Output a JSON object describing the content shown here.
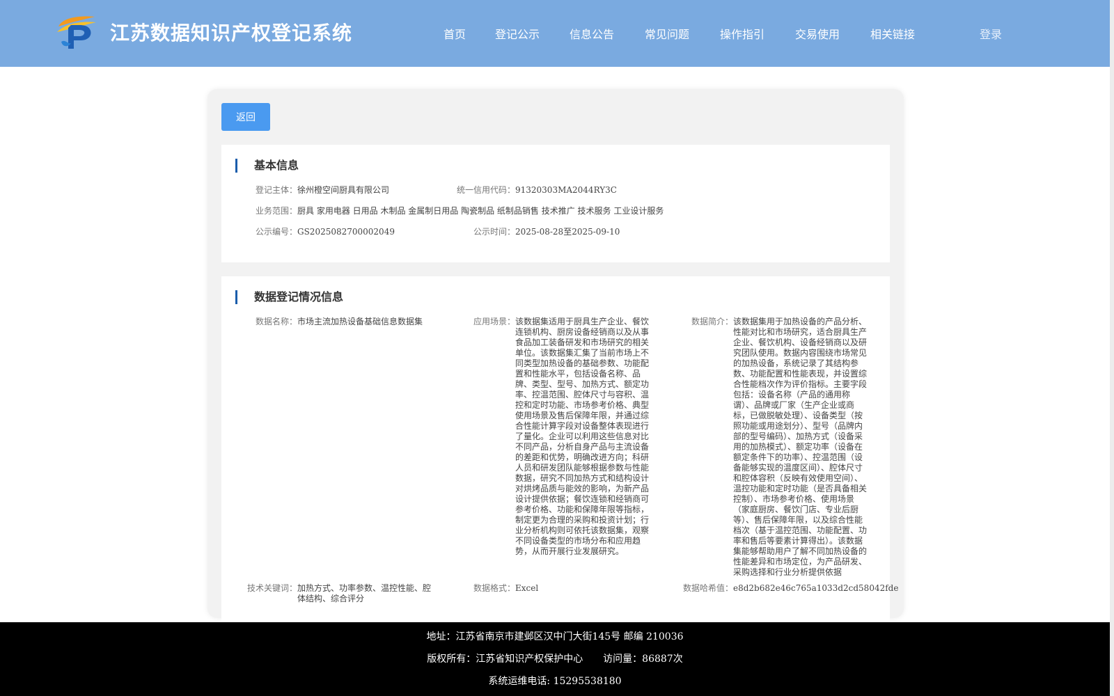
{
  "header": {
    "site_title": "江苏数据知识产权登记系统",
    "nav": [
      "首页",
      "登记公示",
      "信息公告",
      "常见问题",
      "操作指引",
      "交易使用",
      "相关链接"
    ],
    "login": "登录",
    "logo_letter": "P"
  },
  "back_button": "返回",
  "basic_info": {
    "title": "基本信息",
    "fields": [
      {
        "label": "登记主体：",
        "value": "徐州橙空间厨具有限公司"
      },
      {
        "label": "统一信用代码：",
        "value": "91320303MA2044RY3C"
      },
      {
        "label": "业务范围：",
        "value": "厨具 家用电器 日用品 木制品 金属制日用品 陶瓷制品 纸制品销售 技术推广 技术服务 工业设计服务"
      },
      {
        "label": "公示编号：",
        "value": "GS2025082700002049"
      },
      {
        "label": "公示时间：",
        "value": "2025-08-28至2025-09-10"
      }
    ]
  },
  "data_info": {
    "title": "数据登记情况信息",
    "fields": [
      {
        "label": "数据名称：",
        "value": "市场主流加热设备基础信息数据集"
      },
      {
        "label": "应用场景：",
        "value": "该数据集适用于厨具生产企业、餐饮连锁机构、厨房设备经销商以及从事食品加工装备研发和市场研究的相关单位。该数据集汇集了当前市场上不同类型加热设备的基础参数、功能配置和性能水平，包括设备名称、品牌、类型、型号、加热方式、额定功率、控温范围、腔体尺寸与容积、温控和定时功能、市场参考价格、典型使用场景及售后保障年限，并通过综合性能计算字段对设备整体表现进行了量化。企业可以利用这些信息对比不同产品，分析自身产品与主流设备的差距和优势，明确改进方向；科研人员和研发团队能够根据参数与性能数据，研究不同加热方式和结构设计对烘烤品质与能效的影响，为新产品设计提供依据；餐饮连锁和经销商可参考价格、功能和保障年限等指标，制定更为合理的采购和投资计划；行业分析机构则可依托该数据集，观察不同设备类型的市场分布和应用趋势，从而开展行业发展研究。"
      },
      {
        "label": "数据简介：",
        "value": "该数据集用于加热设备的产品分析、性能对比和市场研究，适合厨具生产企业、餐饮机构、设备经销商以及研究团队使用。数据内容围绕市场常见的加热设备，系统记录了其结构参数、功能配置和性能表现，并设置综合性能档次作为评价指标。主要字段包括：设备名称（产品的通用称谓）、品牌或厂家（生产企业或商标，已做脱敏处理）、设备类型（按照功能或用途划分）、型号（品牌内部的型号编码）、加热方式（设备采用的加热模式）、额定功率（设备在额定条件下的功率）、控温范围（设备能够实现的温度区间）、腔体尺寸和腔体容积（反映有效使用空间）、温控功能和定时功能（是否具备相关控制）、市场参考价格、使用场景（家庭厨房、餐饮门店、专业后厨等）、售后保障年限，以及综合性能档次（基于温控范围、功能配置、功率和售后等要素计算得出）。该数据集能够帮助用户了解不同加热设备的性能差异和市场定位，为产品研发、采购选择和行业分析提供依据"
      },
      {
        "label": "技术关键词：",
        "value": "加热方式、功率参数、温控性能、腔体结构、综合评分"
      },
      {
        "label": "数据格式：",
        "value": "Excel"
      },
      {
        "label": "数据哈希值：",
        "value": "e8d2b682e46c765a1033d2cd58042fde"
      }
    ]
  },
  "footer": {
    "address": "地址：江苏省南京市建邺区汉中门大街145号 邮编 210036",
    "copyright": "版权所有：江苏省知识产权保护中心",
    "visits": "访问量：86887次",
    "phone": "系统运维电话: 15295538180"
  },
  "colors": {
    "header_bg": "#7aaae0",
    "button_bg": "#4a9af0",
    "section_bar": "#1a5dab",
    "footer_bg": "#000000"
  }
}
